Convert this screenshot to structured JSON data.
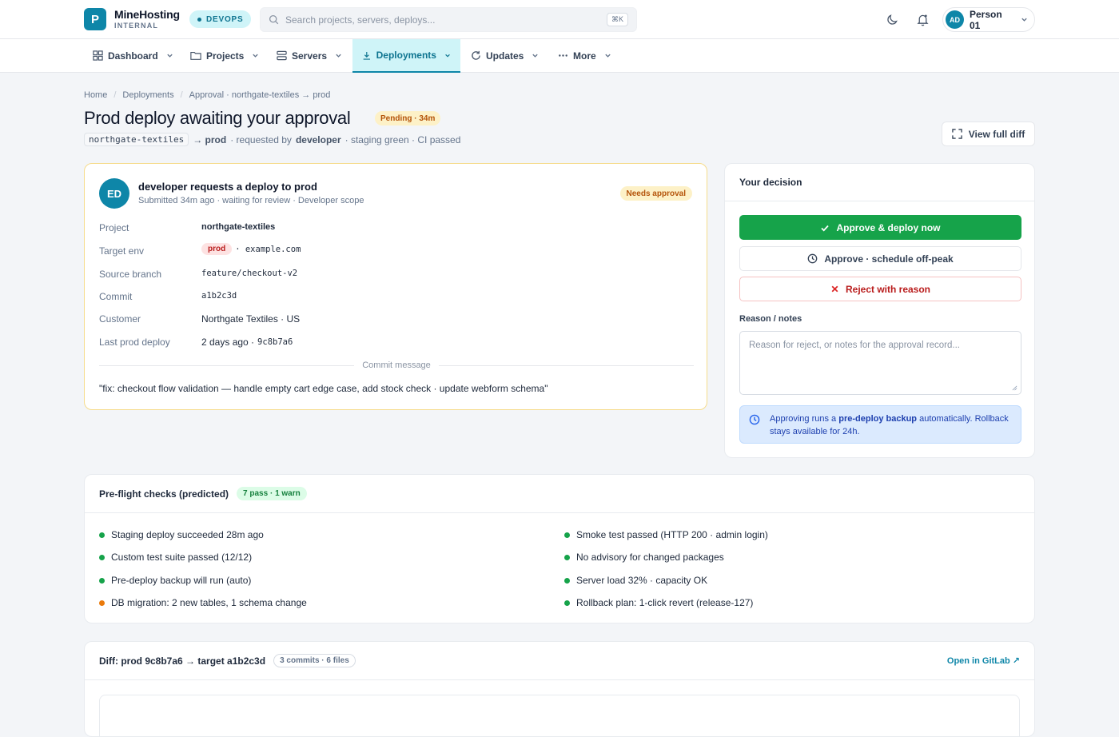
{
  "app": {
    "brand_name": "MineHosting",
    "brand_sub": "INTERNAL",
    "logo_letter": "P",
    "env_label": "DEVOPS",
    "accent": "#0e86a8"
  },
  "search": {
    "placeholder": "Search projects, servers, deploys...",
    "shortcut": "⌘K"
  },
  "user": {
    "initials": "AD",
    "name": "Person 01"
  },
  "nav": [
    {
      "label": "Dashboard",
      "icon": "grid-icon"
    },
    {
      "label": "Projects",
      "icon": "folder-icon"
    },
    {
      "label": "Servers",
      "icon": "server-icon"
    },
    {
      "label": "Deployments",
      "icon": "download-icon",
      "active": true
    },
    {
      "label": "Updates",
      "icon": "refresh-icon"
    },
    {
      "label": "More",
      "icon": "dots-icon"
    }
  ],
  "breadcrumb": [
    "Home",
    "Deployments",
    "Approval · northgate-textiles → prod"
  ],
  "page": {
    "title": "Prod deploy awaiting your approval",
    "status": "Pending · 34m",
    "project_code": "northgate-textiles",
    "arrow_target": "→ prod",
    "requested_by_prefix": "· requested by",
    "requester": "developer",
    "suffix": "· staging green · CI passed",
    "view_diff": "View full diff"
  },
  "request": {
    "initials": "ED",
    "title": "developer requests a deploy to prod",
    "subtitle": "Submitted 34m ago · waiting for review · Developer scope",
    "badge": "Needs approval",
    "fields": {
      "project_label": "Project",
      "project_value": "northgate-textiles",
      "env_label": "Target env",
      "env_badge": "prod",
      "env_host": "· example.com",
      "branch_label": "Source branch",
      "branch_value": "feature/checkout-v2",
      "commit_label": "Commit",
      "commit_value": "a1b2c3d",
      "customer_label": "Customer",
      "customer_value": "Northgate Textiles · US",
      "last_label": "Last prod deploy",
      "last_value": "2 days ago ·",
      "last_hash": "9c8b7a6"
    },
    "commit_heading": "Commit message",
    "commit_message": "\"fix: checkout flow validation — handle empty cart edge case, add stock check · update webform schema\""
  },
  "decision": {
    "heading": "Your decision",
    "approve": "Approve & deploy now",
    "schedule": "Approve · schedule off-peak",
    "reject": "Reject with reason",
    "notes_label": "Reason / notes",
    "notes_placeholder": "Reason for reject, or notes for the approval record...",
    "info_prefix": "Approving runs a",
    "info_bold": "pre-deploy backup",
    "info_suffix": "automatically. Rollback stays available for 24h."
  },
  "preflight": {
    "heading": "Pre-flight checks (predicted)",
    "summary": "7 pass · 1 warn",
    "checks": [
      {
        "text": "Staging deploy succeeded 28m ago",
        "status": "pass"
      },
      {
        "text": "Custom test suite passed (12/12)",
        "status": "pass"
      },
      {
        "text": "Pre-deploy backup will run (auto)",
        "status": "pass"
      },
      {
        "text": "DB migration: 2 new tables, 1 schema change",
        "status": "warn"
      },
      {
        "text": "Smoke test passed (HTTP 200 · admin login)",
        "status": "pass"
      },
      {
        "text": "No advisory for changed packages",
        "status": "pass"
      },
      {
        "text": "Server load 32% · capacity OK",
        "status": "pass"
      },
      {
        "text": "Rollback plan: 1-click revert (release-127)",
        "status": "pass"
      }
    ],
    "colors": {
      "pass": "#16a34a",
      "warn": "#ea7a0c"
    }
  },
  "diff": {
    "heading": "Diff: prod 9c8b7a6 → target a1b2c3d",
    "meta": "3 commits · 6 files",
    "open_link": "Open in GitLab ↗"
  }
}
